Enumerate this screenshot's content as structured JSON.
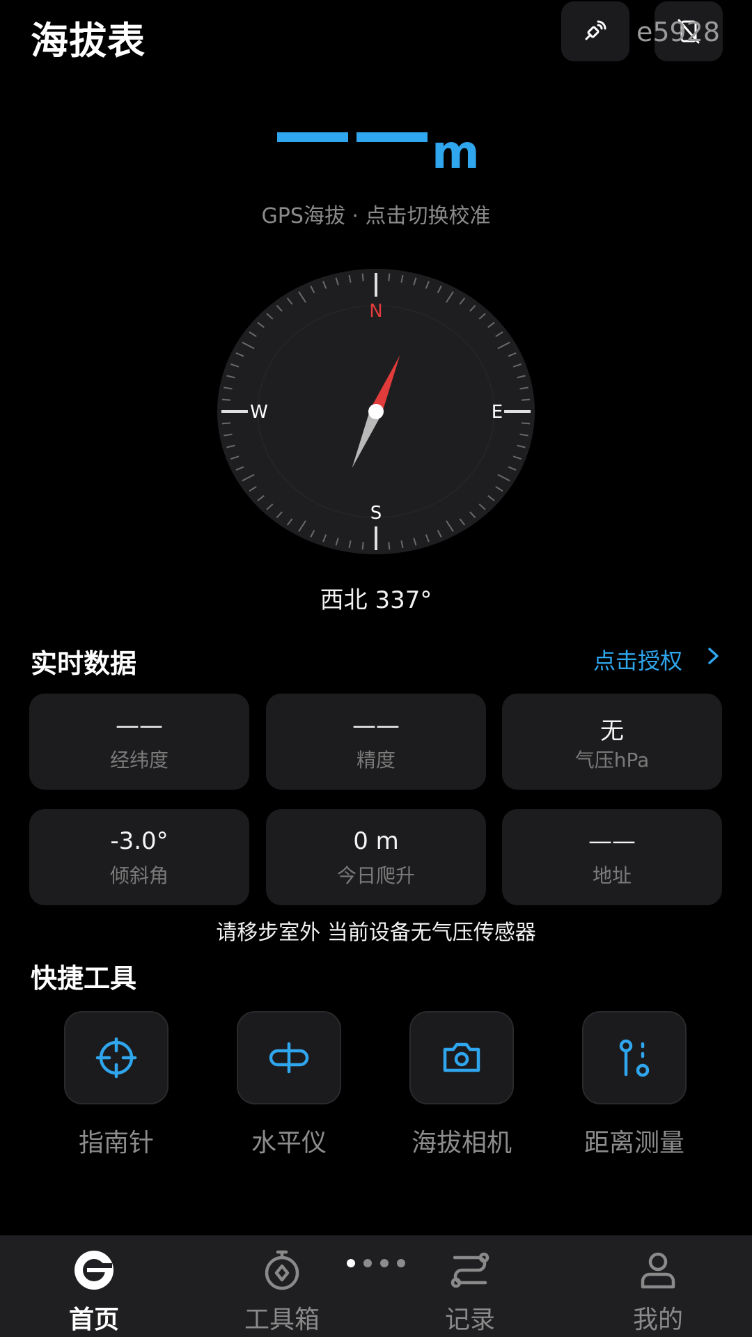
{
  "header": {
    "title": "海拔表",
    "device_code": "e5928",
    "satellite_icon": "satellite-icon",
    "secondary_icon": "signal-off-icon"
  },
  "altitude": {
    "unit": "m",
    "hint": "GPS海拔 · 点击切换校准"
  },
  "compass": {
    "north": "N",
    "east": "E",
    "south": "S",
    "west": "W",
    "heading_deg": 337,
    "heading_text": "西北 337°"
  },
  "realtime": {
    "title": "实时数据",
    "auth_link": "点击授权",
    "cards": [
      {
        "value": "——",
        "label": "经纬度"
      },
      {
        "value": "——",
        "label": "精度"
      },
      {
        "value": "无",
        "label": "气压hPa"
      },
      {
        "value": "-3.0°",
        "label": "倾斜角"
      },
      {
        "value": "0 m",
        "label": "今日爬升"
      },
      {
        "value": "——",
        "label": "地址"
      }
    ],
    "notice": "请移步室外 当前设备无气压传感器"
  },
  "tools": {
    "title": "快捷工具",
    "items": [
      {
        "label": "指南针",
        "icon": "crosshair-icon"
      },
      {
        "label": "水平仪",
        "icon": "level-icon"
      },
      {
        "label": "海拔相机",
        "icon": "camera-icon"
      },
      {
        "label": "距离测量",
        "icon": "distance-icon"
      }
    ]
  },
  "nav": {
    "items": [
      {
        "label": "首页",
        "icon": "home-icon",
        "active": true
      },
      {
        "label": "工具箱",
        "icon": "toolbox-icon",
        "active": false
      },
      {
        "label": "记录",
        "icon": "route-icon",
        "active": false
      },
      {
        "label": "我的",
        "icon": "user-icon",
        "active": false
      }
    ],
    "pager_active_index": 0,
    "pager_count": 4
  },
  "colors": {
    "accent": "#2fa6ee",
    "needle_north": "#e23b3b",
    "needle_south": "#b9b9b9",
    "card_bg": "#1c1c1e"
  }
}
